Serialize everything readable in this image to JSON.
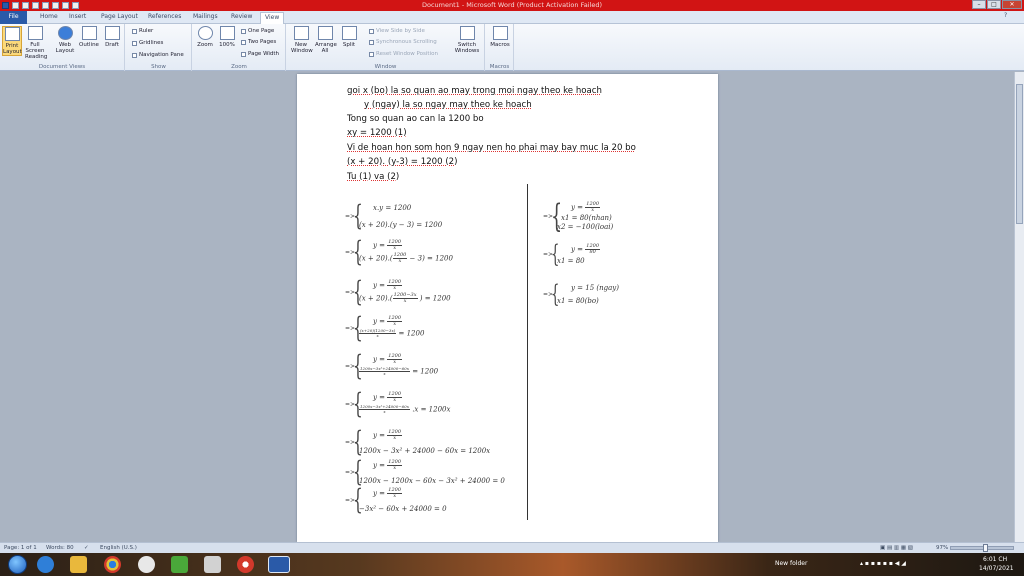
{
  "window": {
    "title": "Document1 - Microsoft Word (Product Activation Failed)",
    "controls": {
      "minimize": "–",
      "maximize": "□",
      "close": "✕"
    }
  },
  "tabs": [
    "File",
    "Home",
    "Insert",
    "Page Layout",
    "References",
    "Mailings",
    "Review",
    "View"
  ],
  "active_tab": "View",
  "ribbon": {
    "document_views": {
      "label": "Document Views",
      "buttons": [
        "Print Layout",
        "Full Screen Reading",
        "Web Layout",
        "Outline",
        "Draft"
      ]
    },
    "show": {
      "label": "Show",
      "items": [
        "Ruler",
        "Gridlines",
        "Navigation Pane"
      ]
    },
    "zoom": {
      "label": "Zoom",
      "buttons": [
        "Zoom",
        "100%"
      ],
      "small": [
        "One Page",
        "Two Pages",
        "Page Width"
      ]
    },
    "window": {
      "label": "Window",
      "buttons": [
        "New Window",
        "Arrange All",
        "Split"
      ],
      "small": [
        "View Side by Side",
        "Synchronous Scrolling",
        "Reset Window Position"
      ],
      "switch": "Switch Windows"
    },
    "macros": {
      "label": "Macros",
      "button": "Macros"
    }
  },
  "document": {
    "lines": [
      "goi x (bo) la so quan ao may trong moi ngay theo ke hoach",
      "y (ngay) la so ngay may theo ke hoach",
      "Tong so quan ao can la 1200 bo",
      "xy = 1200 (1)",
      "Vi de hoan hon som hon 9 ngay nen ho phai may bay muc la 20 bo",
      "(x + 20). (y-3) = 1200 (2)",
      "Tu (1) va (2)"
    ],
    "arrow": "=>",
    "left_eqs": [
      {
        "top": "x.y = 1200",
        "bottom": "(x + 20).(y − 3) = 1200"
      },
      {
        "top_lhs": "y =",
        "top_num": "1200",
        "top_den": "x",
        "bottom_pre": "(x + 20).(",
        "bottom_num": "1200",
        "bottom_den": "x",
        "bottom_post": "− 3) = 1200"
      },
      {
        "top_lhs": "y =",
        "top_num": "1200",
        "top_den": "x",
        "bottom_pre": "(x + 20).(",
        "bottom_num": "1200−3x",
        "bottom_den": "x",
        "bottom_post": ") = 1200"
      },
      {
        "top_lhs": "y =",
        "top_num": "1200",
        "top_den": "x",
        "bottom_num": "(x+20)(1200−3x)",
        "bottom_den": "x",
        "bottom_post": "= 1200"
      },
      {
        "top_lhs": "y =",
        "top_num": "1200",
        "top_den": "x",
        "bottom_num": "1200x−3x²+24000−60x",
        "bottom_den": "x",
        "bottom_post": "= 1200"
      },
      {
        "top_lhs": "y =",
        "top_num": "1200",
        "top_den": "x",
        "bottom_num": "1200x−3x²+24000−60x",
        "bottom_den": "x",
        "bottom_post": ".x = 1200x"
      },
      {
        "top_lhs": "y =",
        "top_num": "1200",
        "top_den": "x",
        "bottom": "1200x − 3x² + 24000 − 60x = 1200x"
      },
      {
        "top_lhs": "y =",
        "top_num": "1200",
        "top_den": "x",
        "bottom": "1200x − 1200x − 60x − 3x² + 24000 = 0"
      },
      {
        "top_lhs": "y =",
        "top_num": "1200",
        "top_den": "x",
        "bottom": "−3x² − 60x + 24000 = 0"
      }
    ],
    "right_eqs": [
      {
        "top_lhs": "y =",
        "top_num": "1200",
        "top_den": "x",
        "mid": "x1 = 80(nhan)",
        "bottom": "x2 = −100(loai)"
      },
      {
        "top_lhs": "y =",
        "top_num": "1200",
        "top_den": "80",
        "bottom": "x1 = 80"
      },
      {
        "top": "y = 15 (ngay)",
        "bottom": "x1 = 80(bo)"
      }
    ]
  },
  "status_bar": {
    "page": "Page: 1 of 1",
    "words": "Words: 80",
    "language": "English (U.S.)",
    "zoom": "97%"
  },
  "taskbar": {
    "tray_label": "New folder",
    "time": "6:01 CH",
    "date": "14/07/2021"
  }
}
